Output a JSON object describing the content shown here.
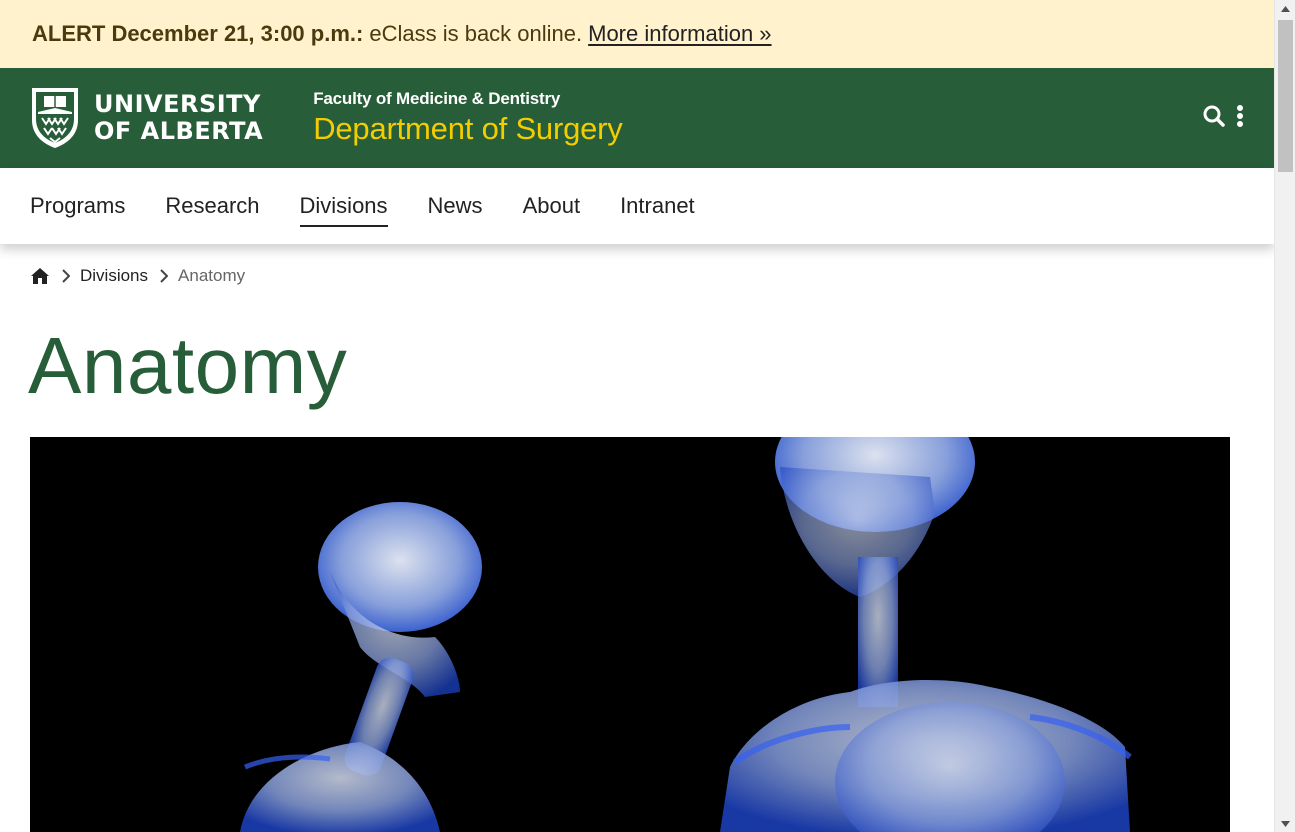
{
  "alert": {
    "label": "ALERT December 21, 3:00 p.m.:",
    "message": "eClass is back online.",
    "link": "More information »"
  },
  "header": {
    "logo_line1": "UNIVERSITY",
    "logo_line2": "OF ALBERTA",
    "faculty": "Faculty of Medicine & Dentistry",
    "department": "Department of Surgery",
    "icons": [
      "search-icon",
      "more-vertical-icon"
    ]
  },
  "nav": {
    "items": [
      {
        "label": "Programs"
      },
      {
        "label": "Research"
      },
      {
        "label": "Divisions"
      },
      {
        "label": "News"
      },
      {
        "label": "About"
      },
      {
        "label": "Intranet"
      }
    ],
    "active": "Divisions"
  },
  "breadcrumb": {
    "items": [
      {
        "label": "Divisions"
      },
      {
        "label": "Anatomy"
      }
    ]
  },
  "page": {
    "title": "Anatomy",
    "hero_image": "x-ray skeletons with brains on black background"
  },
  "colors": {
    "brand_green": "#275d38",
    "brand_gold": "#f2cd00",
    "alert_bg": "#fff2cc"
  }
}
